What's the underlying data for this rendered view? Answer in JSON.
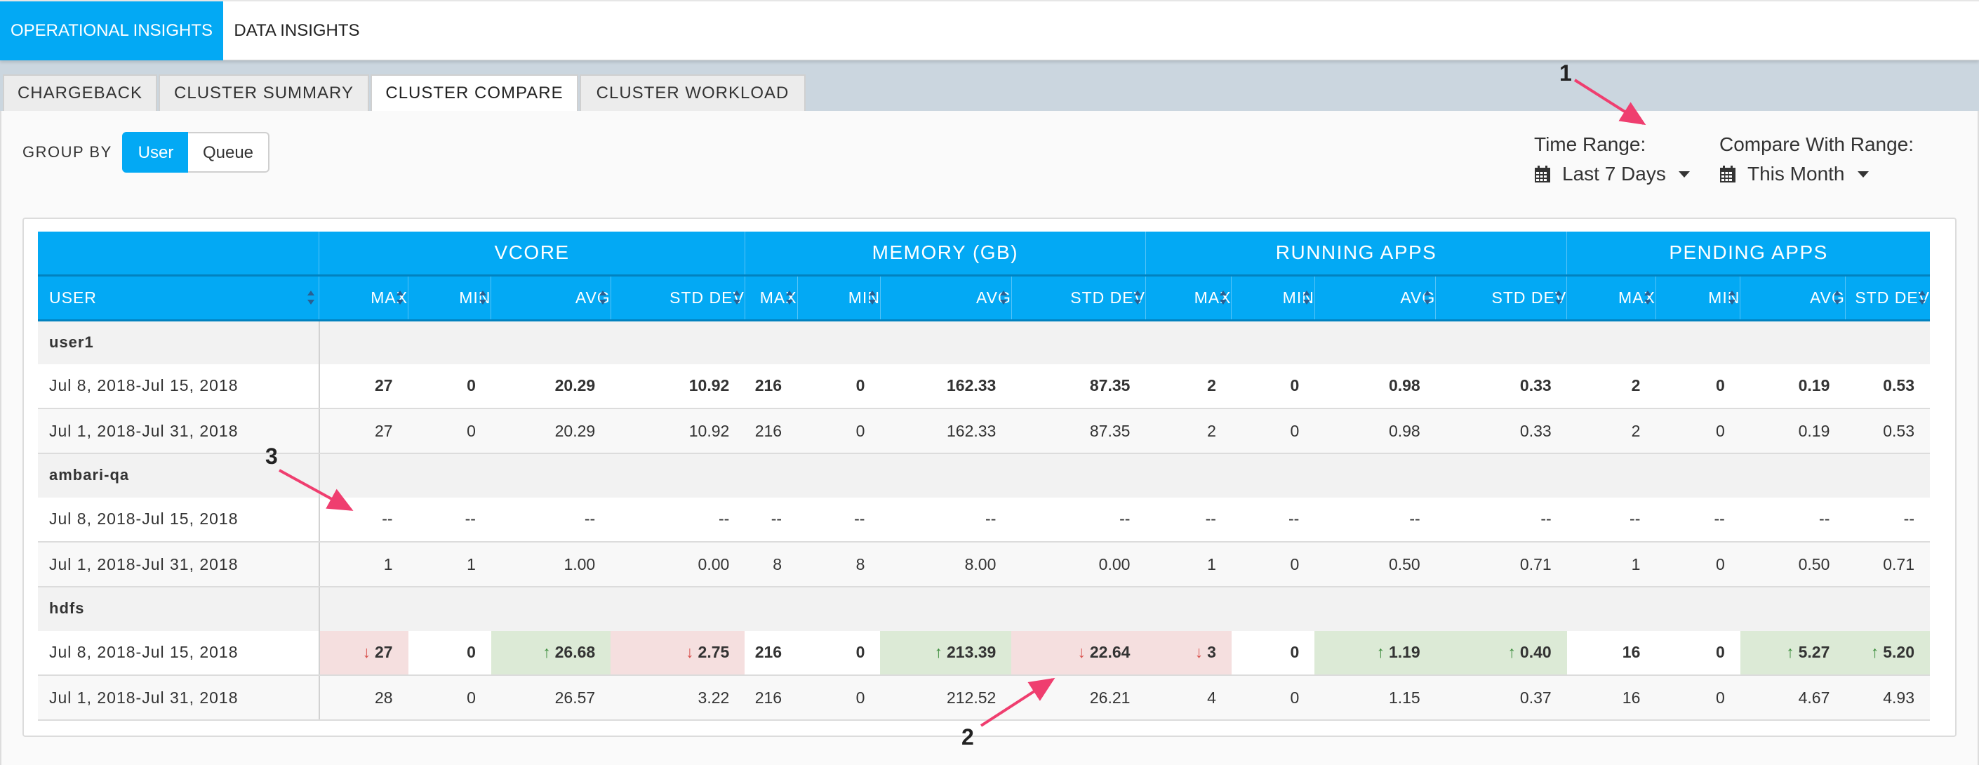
{
  "nav": {
    "tabs": [
      "OPERATIONAL INSIGHTS",
      "DATA INSIGHTS"
    ],
    "active_index": 0
  },
  "subnav": {
    "tabs": [
      "CHARGEBACK",
      "CLUSTER SUMMARY",
      "CLUSTER COMPARE",
      "CLUSTER WORKLOAD"
    ],
    "active_index": 2
  },
  "group_by": {
    "label": "GROUP BY",
    "options": [
      "User",
      "Queue"
    ],
    "selected": "User"
  },
  "time_range": {
    "label": "Time Range:",
    "value": "Last 7 Days",
    "icon": "calendar-icon"
  },
  "compare_range": {
    "label": "Compare With Range:",
    "value": "This Month",
    "icon": "calendar-icon"
  },
  "annotations": [
    "1",
    "2",
    "3"
  ],
  "colors": {
    "accent": "#03a9f4",
    "decrease_bg": "#f5dfdf",
    "increase_bg": "#dcead6",
    "down_arrow": "#d9534f",
    "up_arrow": "#3c8d3c",
    "annotation_arrow": "#ef3e6f"
  },
  "table": {
    "groups": [
      "VCORE",
      "MEMORY (GB)",
      "RUNNING APPS",
      "PENDING APPS"
    ],
    "user_header": "USER",
    "sub_columns": [
      "MAX",
      "MIN",
      "AVG",
      "STD DEV"
    ],
    "rows": [
      {
        "user": "user1",
        "periods": [
          {
            "range": "Jul 8, 2018-Jul 15, 2018",
            "bold": true,
            "values": [
              "27",
              "0",
              "20.29",
              "10.92",
              "216",
              "0",
              "162.33",
              "87.35",
              "2",
              "0",
              "0.98",
              "0.33",
              "2",
              "0",
              "0.19",
              "0.53"
            ],
            "trend": [
              "",
              "",
              "",
              "",
              "",
              "",
              "",
              "",
              "",
              "",
              "",
              "",
              "",
              "",
              "",
              ""
            ]
          },
          {
            "range": "Jul 1, 2018-Jul 31, 2018",
            "bold": false,
            "values": [
              "27",
              "0",
              "20.29",
              "10.92",
              "216",
              "0",
              "162.33",
              "87.35",
              "2",
              "0",
              "0.98",
              "0.33",
              "2",
              "0",
              "0.19",
              "0.53"
            ],
            "trend": [
              "",
              "",
              "",
              "",
              "",
              "",
              "",
              "",
              "",
              "",
              "",
              "",
              "",
              "",
              "",
              ""
            ]
          }
        ]
      },
      {
        "user": "ambari-qa",
        "periods": [
          {
            "range": "Jul 8, 2018-Jul 15, 2018",
            "bold": false,
            "values": [
              "--",
              "--",
              "--",
              "--",
              "--",
              "--",
              "--",
              "--",
              "--",
              "--",
              "--",
              "--",
              "--",
              "--",
              "--",
              "--"
            ],
            "trend": [
              "",
              "",
              "",
              "",
              "",
              "",
              "",
              "",
              "",
              "",
              "",
              "",
              "",
              "",
              "",
              ""
            ]
          },
          {
            "range": "Jul 1, 2018-Jul 31, 2018",
            "bold": false,
            "values": [
              "1",
              "1",
              "1.00",
              "0.00",
              "8",
              "8",
              "8.00",
              "0.00",
              "1",
              "0",
              "0.50",
              "0.71",
              "1",
              "0",
              "0.50",
              "0.71"
            ],
            "trend": [
              "",
              "",
              "",
              "",
              "",
              "",
              "",
              "",
              "",
              "",
              "",
              "",
              "",
              "",
              "",
              ""
            ]
          }
        ]
      },
      {
        "user": "hdfs",
        "periods": [
          {
            "range": "Jul 8, 2018-Jul 15, 2018",
            "bold": true,
            "values": [
              "27",
              "0",
              "26.68",
              "2.75",
              "216",
              "0",
              "213.39",
              "22.64",
              "3",
              "0",
              "1.19",
              "0.40",
              "16",
              "0",
              "5.27",
              "5.20"
            ],
            "trend": [
              "down",
              "",
              "up",
              "down",
              "",
              "",
              "up",
              "down",
              "down",
              "",
              "up",
              "up",
              "",
              "",
              "up",
              "up"
            ]
          },
          {
            "range": "Jul 1, 2018-Jul 31, 2018",
            "bold": false,
            "values": [
              "28",
              "0",
              "26.57",
              "3.22",
              "216",
              "0",
              "212.52",
              "26.21",
              "4",
              "0",
              "1.15",
              "0.37",
              "16",
              "0",
              "4.67",
              "4.93"
            ],
            "trend": [
              "",
              "",
              "",
              "",
              "",
              "",
              "",
              "",
              "",
              "",
              "",
              "",
              "",
              "",
              "",
              ""
            ]
          }
        ]
      }
    ]
  }
}
